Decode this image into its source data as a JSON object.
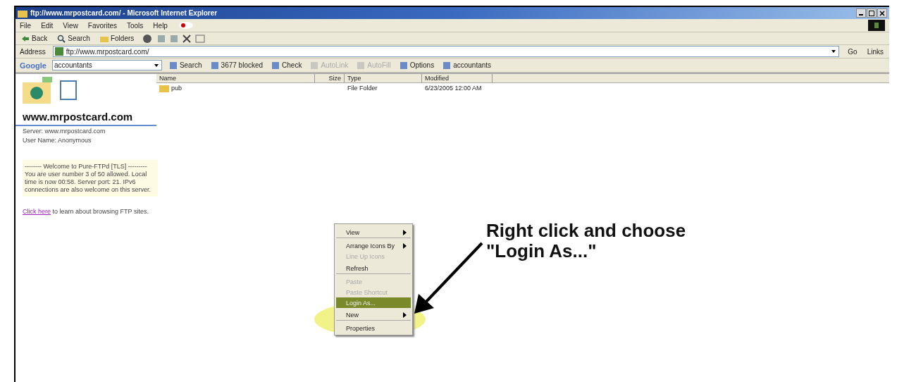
{
  "window": {
    "title": "ftp://www.mrpostcard.com/ - Microsoft Internet Explorer"
  },
  "menu_bar": [
    "File",
    "Edit",
    "View",
    "Favorites",
    "Tools",
    "Help"
  ],
  "toolbar": [
    {
      "label": "Back",
      "kind": "back"
    },
    {
      "label": "Search",
      "kind": "search"
    },
    {
      "label": "Folders",
      "kind": "folders"
    }
  ],
  "address": {
    "label": "Address",
    "value": "ftp://www.mrpostcard.com/",
    "go": "Go",
    "links": "Links"
  },
  "google_bar": {
    "logo": "Google",
    "query": "accountants",
    "items": [
      {
        "label": "Search",
        "disabled": false
      },
      {
        "label": "3677 blocked",
        "disabled": false
      },
      {
        "label": "Check",
        "disabled": false
      },
      {
        "label": "AutoLink",
        "disabled": true
      },
      {
        "label": "AutoFill",
        "disabled": true
      },
      {
        "label": "Options",
        "disabled": false
      },
      {
        "label": "accountants",
        "disabled": false
      }
    ]
  },
  "left_panel": {
    "site": "www.mrpostcard.com",
    "server": "Server: www.mrpostcard.com",
    "user": "User Name: Anonymous",
    "welcome": "-------- Welcome to Pure-FTPd [TLS] --------- You are user number 3 of 50 allowed. Local time is now 00:58. Server port: 21. IPv6 connections are also welcome on this server.",
    "link": "Click here",
    "link_rest": "to learn about browsing FTP sites."
  },
  "file_list": {
    "columns": [
      "Name",
      "Size",
      "Type",
      "Modified"
    ],
    "rows": [
      {
        "name": "pub",
        "size": "",
        "type": "File Folder",
        "modified": "6/23/2005 12:00 AM"
      }
    ]
  },
  "context_menu": [
    {
      "label": "View",
      "submenu": true,
      "disabled": false,
      "selected": false,
      "separator_after": true
    },
    {
      "label": "Arrange Icons By",
      "submenu": true,
      "disabled": false,
      "selected": false,
      "separator_after": false
    },
    {
      "label": "Line Up Icons",
      "submenu": false,
      "disabled": true,
      "selected": false,
      "separator_after": false
    },
    {
      "label": "Refresh",
      "submenu": false,
      "disabled": false,
      "selected": false,
      "separator_after": true
    },
    {
      "label": "Paste",
      "submenu": false,
      "disabled": true,
      "selected": false,
      "separator_after": false
    },
    {
      "label": "Paste Shortcut",
      "submenu": false,
      "disabled": true,
      "selected": false,
      "separator_after": false
    },
    {
      "label": "Login As...",
      "submenu": false,
      "disabled": false,
      "selected": true,
      "separator_after": false
    },
    {
      "label": "New",
      "submenu": true,
      "disabled": false,
      "selected": false,
      "separator_after": true
    },
    {
      "label": "Properties",
      "submenu": false,
      "disabled": false,
      "selected": false,
      "separator_after": false
    }
  ],
  "annotation": {
    "line_1": "Right click and choose",
    "line_2": "\"Login As...\""
  }
}
